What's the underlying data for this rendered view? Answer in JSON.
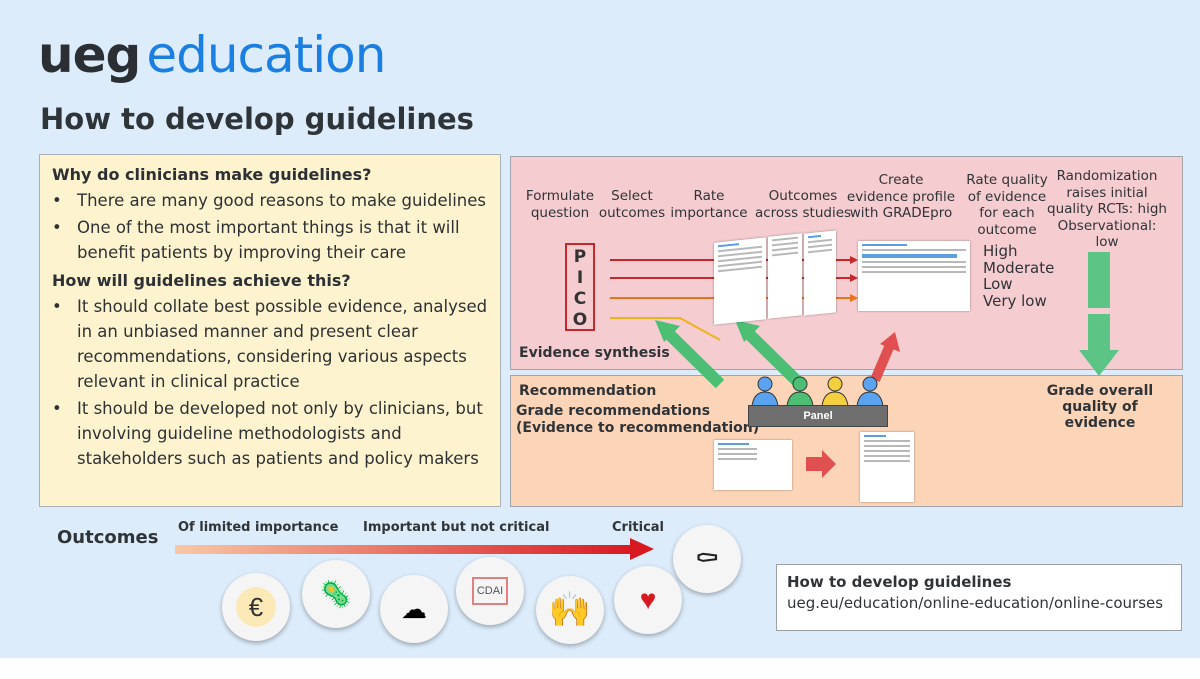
{
  "brand": {
    "ueg": "ueg",
    "education": "education"
  },
  "title": "How to develop guidelines",
  "left_panel": {
    "q1": "Why do clinicians make guidelines?",
    "q1_bullets": [
      "There are many good reasons to make guidelines",
      "One of the most important things is that it will benefit patients by improving their care"
    ],
    "q2": "How will guidelines achieve this?",
    "q2_bullets": [
      "It should collate best possible evidence, analysed in an unbiased manner and present clear recommendations, considering various aspects relevant in clinical practice",
      "It should be developed not only by clinicians, but involving guideline methodologists and stakeholders such as patients and policy makers"
    ]
  },
  "evidence": {
    "steps": [
      "Formulate question",
      "Select outcomes",
      "Rate importance",
      "Outcomes across studies",
      "Create evidence profile with GRADEpro",
      "Rate quality of evidence for each outcome",
      "Randomization raises initial quality RCTs: high Observational: low"
    ],
    "pico": [
      "P",
      "I",
      "C",
      "O"
    ],
    "grades": [
      "High",
      "Moderate",
      "Low",
      "Very low"
    ],
    "section_label": "Evidence synthesis"
  },
  "recommendation": {
    "section_label": "Recommendation",
    "grade_rec": "Grade recommendations",
    "etr": "(Evidence to recommendation)",
    "panel": "Panel",
    "grade_overall": "Grade overall quality of evidence"
  },
  "outcomes": {
    "label": "Outcomes",
    "scale": [
      "Of limited importance",
      "Important but not critical",
      "Critical"
    ],
    "icons": [
      "money-bag-icon",
      "bacteria-icon",
      "brain-icon",
      "colon-cdai-icon",
      "person-icon",
      "heart-monitor-icon",
      "coffin-icon"
    ],
    "cdai": "CDAI"
  },
  "link_box": {
    "title": "How to develop guidelines",
    "url": "ueg.eu/education/online-education/online-courses"
  }
}
